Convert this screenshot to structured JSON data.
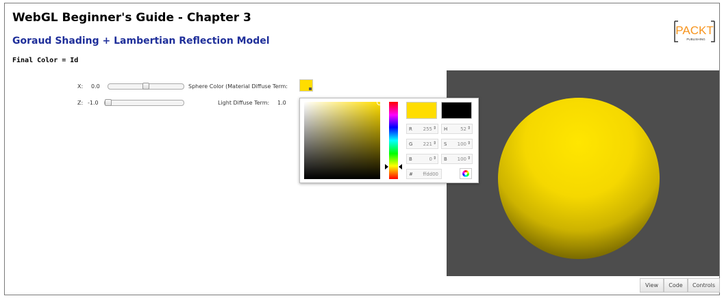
{
  "header": {
    "title": "WebGL Beginner's Guide - Chapter 3",
    "subtitle": "Goraud Shading + Lambertian Reflection Model",
    "formula": "Final Color = Id"
  },
  "logo": {
    "text": "PACKT",
    "subtext": "PUBLISHING"
  },
  "controls": {
    "x": {
      "label": "X:",
      "value": "0.0",
      "slider_fraction": 0.5
    },
    "z": {
      "label": "Z:",
      "value": "-1.0",
      "slider_fraction": 0.0
    },
    "sphere_color": {
      "label": "Sphere Color (Material Diffuse Term:",
      "color": "#ffdd00"
    },
    "light_diffuse": {
      "label": "Light Diffuse Term:",
      "value": "1.0"
    }
  },
  "color_picker": {
    "current_color": "#ffdd00",
    "original_color": "#000000",
    "fields": {
      "r": {
        "label": "R",
        "value": "255"
      },
      "g": {
        "label": "G",
        "value": "221"
      },
      "b": {
        "label": "B",
        "value": "0"
      },
      "h": {
        "label": "H",
        "value": "52"
      },
      "s": {
        "label": "S",
        "value": "100"
      },
      "br": {
        "label": "B",
        "value": "100"
      },
      "hex": {
        "label": "#",
        "value": "ffdd00"
      }
    },
    "spinner_glyph": "⇕"
  },
  "canvas": {
    "background": "#4d4d4d",
    "sphere_color": "#ffdd00"
  },
  "bottom_buttons": {
    "view": "View",
    "code": "Code",
    "controls": "Controls"
  },
  "colors": {
    "accent_title": "#1f2f9a",
    "logo_orange": "#f7941d"
  }
}
